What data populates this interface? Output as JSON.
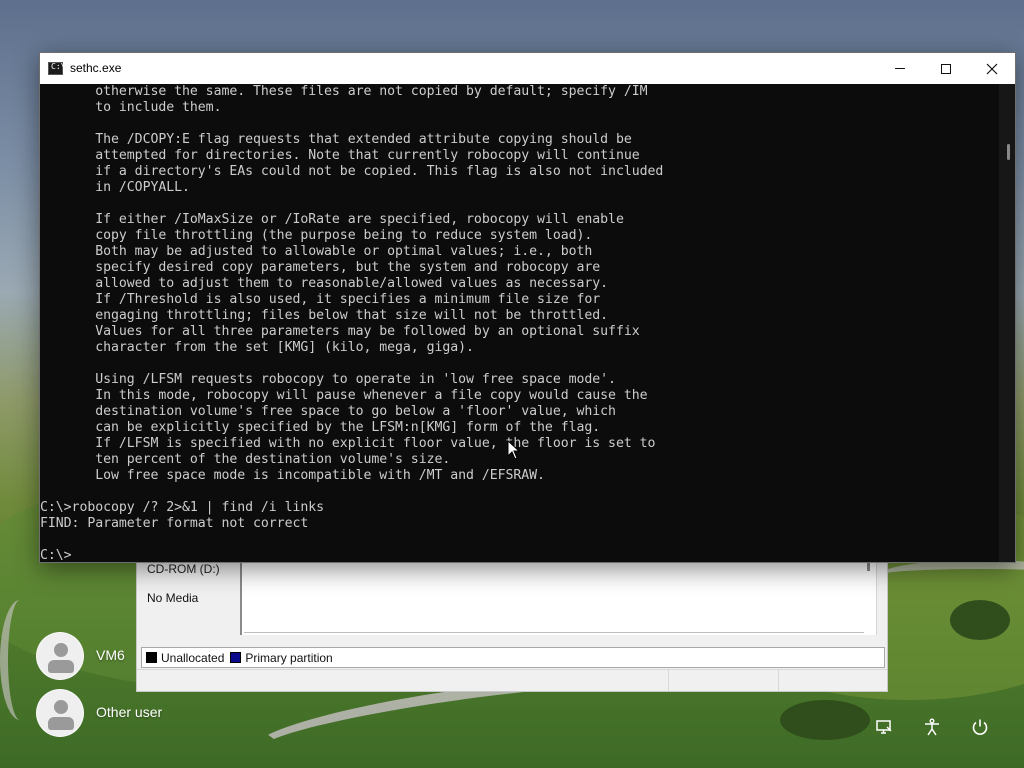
{
  "console": {
    "title": "sethc.exe",
    "icon": "console-icon",
    "icon_glyph": "C:\\",
    "lines": [
      "       otherwise the same. These files are not copied by default; specify /IM",
      "       to include them.",
      "",
      "       The /DCOPY:E flag requests that extended attribute copying should be",
      "       attempted for directories. Note that currently robocopy will continue",
      "       if a directory's EAs could not be copied. This flag is also not included",
      "       in /COPYALL.",
      "",
      "       If either /IoMaxSize or /IoRate are specified, robocopy will enable",
      "       copy file throttling (the purpose being to reduce system load).",
      "       Both may be adjusted to allowable or optimal values; i.e., both",
      "       specify desired copy parameters, but the system and robocopy are",
      "       allowed to adjust them to reasonable/allowed values as necessary.",
      "       If /Threshold is also used, it specifies a minimum file size for",
      "       engaging throttling; files below that size will not be throttled.",
      "       Values for all three parameters may be followed by an optional suffix",
      "       character from the set [KMG] (kilo, mega, giga).",
      "",
      "       Using /LFSM requests robocopy to operate in 'low free space mode'.",
      "       In this mode, robocopy will pause whenever a file copy would cause the",
      "       destination volume's free space to go below a 'floor' value, which",
      "       can be explicitly specified by the LFSM:n[KMG] form of the flag.",
      "       If /LFSM is specified with no explicit floor value, the floor is set to",
      "       ten percent of the destination volume's size.",
      "       Low free space mode is incompatible with /MT and /EFSRAW.",
      "",
      "C:\\>robocopy /? 2>&1 | find /i links",
      "FIND: Parameter format not correct",
      "",
      "C:\\>"
    ]
  },
  "disk_management": {
    "drive_label": "CD-ROM (D:)",
    "media_status": "No Media",
    "legend": [
      {
        "label": "Unallocated",
        "color": "#000000"
      },
      {
        "label": "Primary partition",
        "color": "#0a0a8a"
      }
    ]
  },
  "login": {
    "users": [
      {
        "name": "VM6",
        "icon": "user-avatar-icon"
      },
      {
        "name": "Other user",
        "icon": "user-avatar-icon"
      }
    ],
    "tray_icons": [
      "network-icon",
      "accessibility-icon",
      "power-icon"
    ]
  }
}
